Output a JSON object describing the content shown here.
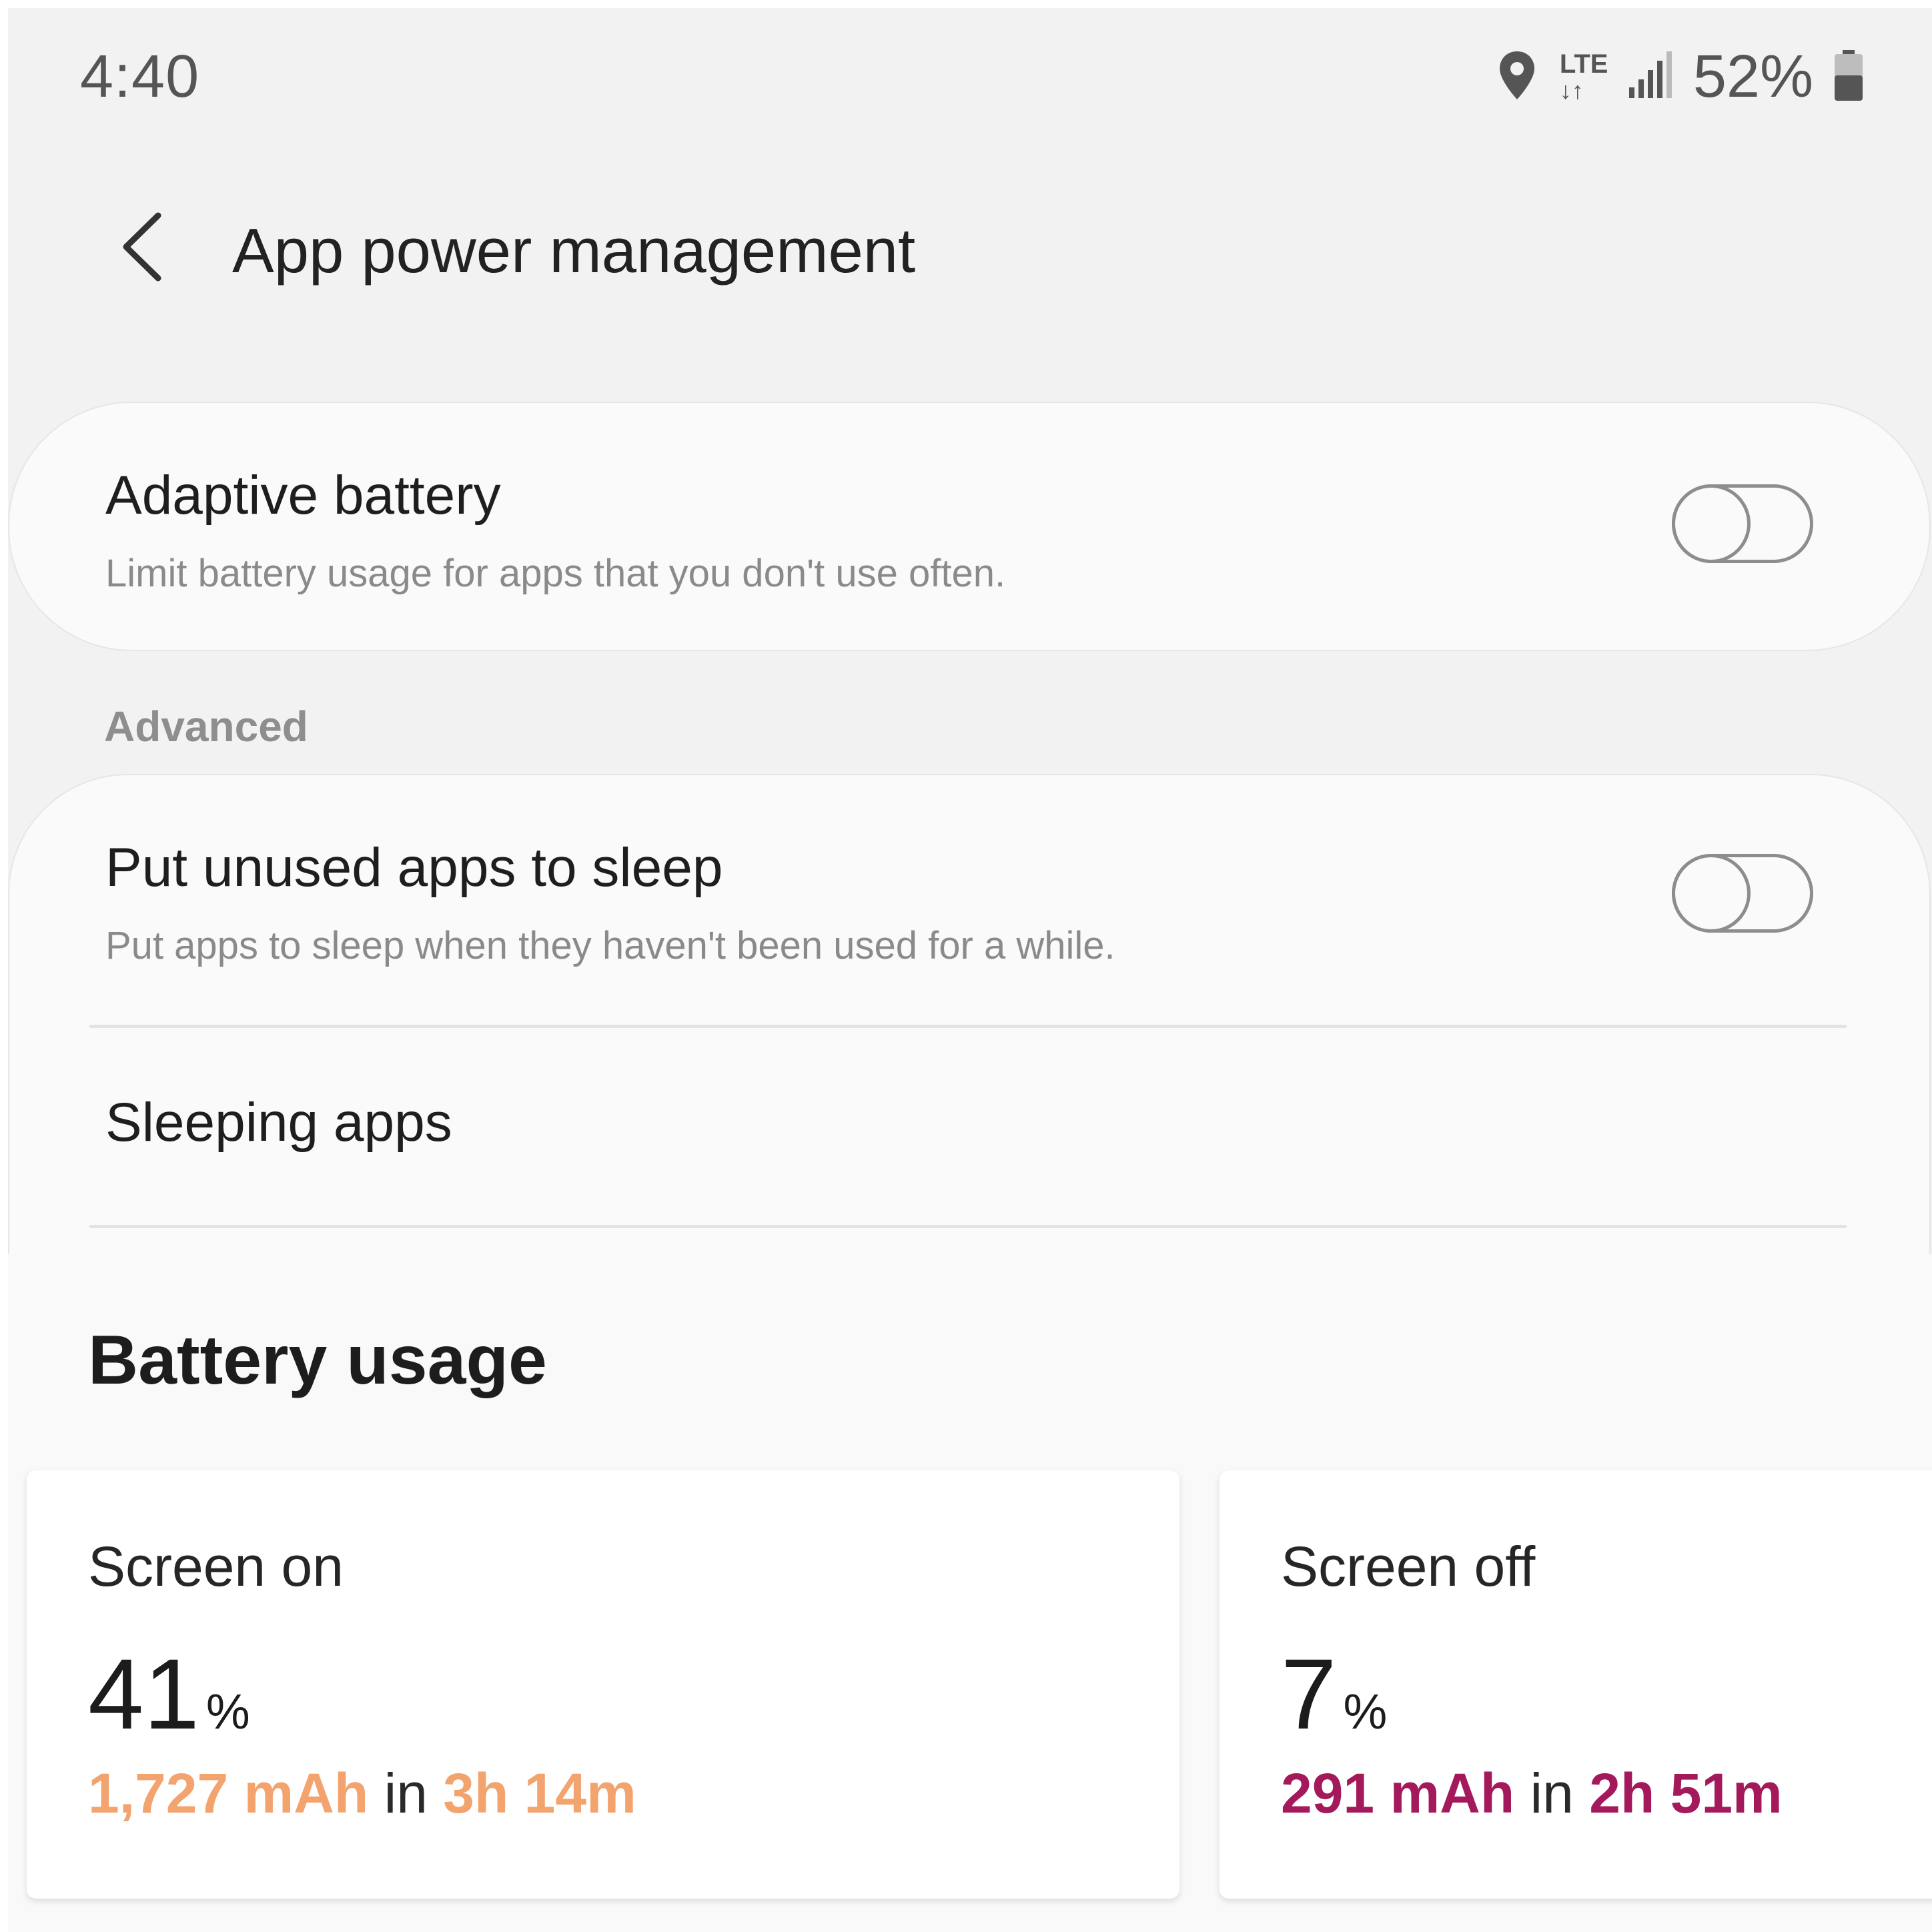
{
  "status_bar": {
    "time": "4:40",
    "network_type": "LTE",
    "battery_percent": "52%",
    "icons": [
      "location-icon",
      "lte-data-icon",
      "signal-icon",
      "battery-icon"
    ]
  },
  "header": {
    "back_icon": "chevron-left-icon",
    "title": "App power management"
  },
  "adaptive_battery": {
    "title": "Adaptive battery",
    "description": "Limit battery usage for apps that you don't use often.",
    "enabled": false
  },
  "advanced": {
    "section_label": "Advanced",
    "put_unused_apps_to_sleep": {
      "title": "Put unused apps to sleep",
      "description": "Put apps to sleep when they haven't been used for a while.",
      "enabled": false
    },
    "sleeping_apps": {
      "title": "Sleeping apps"
    }
  },
  "battery_usage": {
    "heading": "Battery usage",
    "screen_on": {
      "label": "Screen on",
      "percent": "41",
      "percent_sign": "%",
      "mah": "1,727 mAh",
      "in_word": "in",
      "duration": "3h 14m",
      "accent_color": "#f2a36e"
    },
    "screen_off": {
      "label": "Screen off",
      "percent": "7",
      "percent_sign": "%",
      "mah": "291 mAh",
      "in_word": "in",
      "duration": "2h 51m",
      "accent_color": "#a3195b"
    }
  }
}
